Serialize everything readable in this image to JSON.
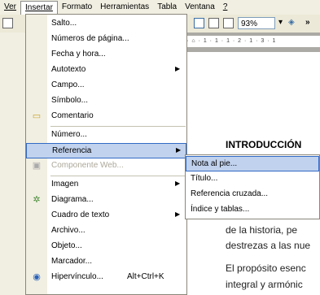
{
  "menubar": {
    "items": [
      {
        "label": "Ver"
      },
      {
        "label": "Insertar"
      },
      {
        "label": "Formato"
      },
      {
        "label": "Herramientas"
      },
      {
        "label": "Tabla"
      },
      {
        "label": "Ventana"
      },
      {
        "label": "?"
      }
    ]
  },
  "toolbar": {
    "zoom": "93%"
  },
  "ruler": {
    "text": "· 1 · ⌂ · 1 · 1 · 1 · 2 · 1 · 3 · 1"
  },
  "insert_menu": {
    "items": [
      {
        "label": "Salto...",
        "icon": "none"
      },
      {
        "label": "Números de página...",
        "icon": "none"
      },
      {
        "label": "Fecha y hora...",
        "icon": "none"
      },
      {
        "label": "Autotexto",
        "icon": "none",
        "submenu": true
      },
      {
        "label": "Campo...",
        "icon": "none"
      },
      {
        "label": "Símbolo...",
        "icon": "none"
      },
      {
        "label": "Comentario",
        "icon": "comment-icon"
      },
      {
        "label": "Número...",
        "icon": "none"
      },
      {
        "label": "Referencia",
        "icon": "none",
        "submenu": true,
        "highlighted": true
      },
      {
        "label": "Componente Web...",
        "icon": "web-component-icon",
        "disabled": true
      },
      {
        "label": "Imagen",
        "icon": "none",
        "submenu": true
      },
      {
        "label": "Diagrama...",
        "icon": "diagram-icon"
      },
      {
        "label": "Cuadro de texto",
        "icon": "none",
        "submenu": true
      },
      {
        "label": "Archivo...",
        "icon": "none"
      },
      {
        "label": "Objeto...",
        "icon": "none"
      },
      {
        "label": "Marcador...",
        "icon": "none"
      },
      {
        "label": "Hipervínculo...",
        "shortcut": "Alt+Ctrl+K",
        "icon": "hyperlink-icon"
      }
    ]
  },
  "reference_submenu": {
    "items": [
      {
        "label": "Nota al pie...",
        "highlighted": true
      },
      {
        "label": "Título..."
      },
      {
        "label": "Referencia cruzada..."
      },
      {
        "label": "Índice y tablas..."
      }
    ]
  },
  "document": {
    "heading": "INTRODUCCIÓN",
    "lines": [
      "de la historia, pe",
      "destrezas a las nue",
      "El propósito esenc",
      "integral y armónic"
    ]
  }
}
